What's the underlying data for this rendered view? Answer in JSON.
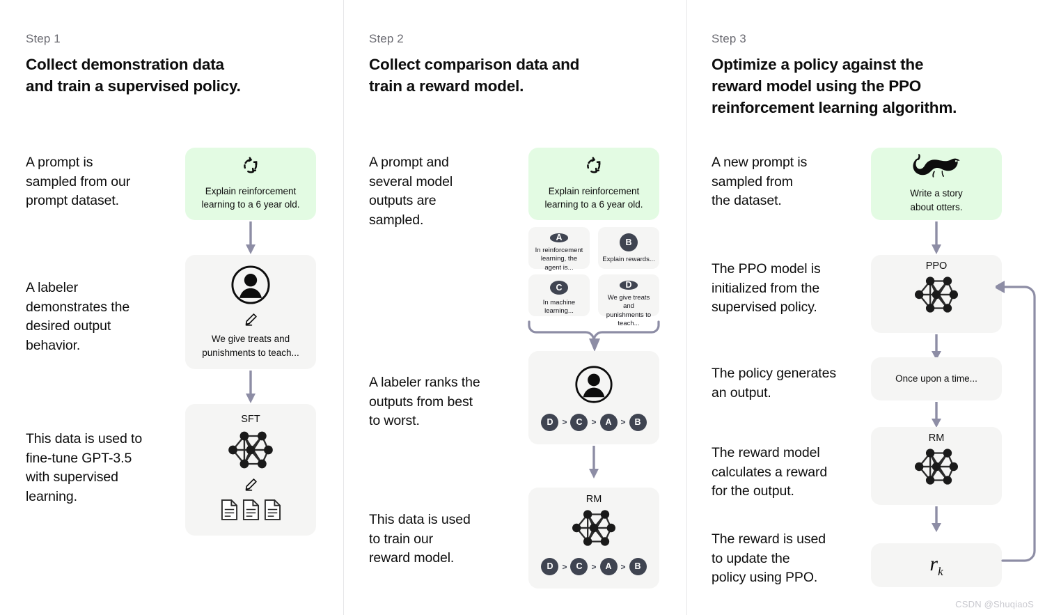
{
  "watermark": "CSDN @ShuqiaoS",
  "colors": {
    "prompt_card_bg": "#e3fbe3",
    "card_bg": "#f5f5f4",
    "arrow": "#8d8da5",
    "badge_bg": "#3f4451",
    "divider": "#e6e6e8",
    "step_label": "#6b6b72",
    "text": "#0d0d0d"
  },
  "columns": [
    {
      "step_label": "Step 1",
      "step_title": "Collect demonstration data\nand train a supervised policy.",
      "notes": [
        "A prompt is\nsampled from our\nprompt dataset.",
        "A labeler\ndemonstrates the\ndesired output\nbehavior.",
        "This data is used to\nfine-tune GPT-3.5\nwith supervised\nlearning."
      ],
      "cards": [
        {
          "icon": "refresh-cycle-icon",
          "text": "Explain reinforcement\nlearning to a 6 year old."
        },
        {
          "icon": "labeler-person-icon",
          "sub_icon": "pencil-icon",
          "text": "We give treats and\npunishments to teach..."
        },
        {
          "title": "SFT",
          "icon": "neural-network-icon",
          "sub_icon": "pencil-icon",
          "extra_icon": "documents-icon"
        }
      ]
    },
    {
      "step_label": "Step 2",
      "step_title": "Collect comparison data and\ntrain a reward model.",
      "notes": [
        "A prompt and\nseveral model\noutputs are\nsampled.",
        "A labeler ranks the\noutputs from best\nto worst.",
        "This data is used\nto train our\nreward model."
      ],
      "cards": [
        {
          "icon": "refresh-cycle-icon",
          "text": "Explain reinforcement\nlearning to a 6 year old."
        },
        {
          "icon": "labeler-person-icon",
          "ranking": [
            "D",
            "C",
            "A",
            "B"
          ]
        },
        {
          "title": "RM",
          "icon": "neural-network-icon",
          "ranking": [
            "D",
            "C",
            "A",
            "B"
          ]
        }
      ],
      "outputs": [
        {
          "letter": "A",
          "text": "In reinforcement\nlearning, the\nagent is..."
        },
        {
          "letter": "B",
          "text": "Explain rewards..."
        },
        {
          "letter": "C",
          "text": "In machine\nlearning..."
        },
        {
          "letter": "D",
          "text": "We give treats and\npunishments to\nteach..."
        }
      ]
    },
    {
      "step_label": "Step 3",
      "step_title": "Optimize a policy against the\nreward model using the PPO\nreinforcement learning algorithm.",
      "notes": [
        "A new prompt is\nsampled from\nthe dataset.",
        "The PPO model is\ninitialized from the\nsupervised policy.",
        "The policy generates\nan output.",
        "The reward model\ncalculates a reward\nfor the output.",
        "The reward is used\nto update the\npolicy using PPO."
      ],
      "cards": [
        {
          "icon": "otter-icon",
          "text": "Write a story\nabout otters."
        },
        {
          "title": "PPO",
          "icon": "neural-network-icon"
        },
        {
          "text": "Once upon a time..."
        },
        {
          "title": "RM",
          "icon": "neural-network-icon"
        },
        {
          "formula_base": "r",
          "formula_sub": "k"
        }
      ]
    }
  ]
}
